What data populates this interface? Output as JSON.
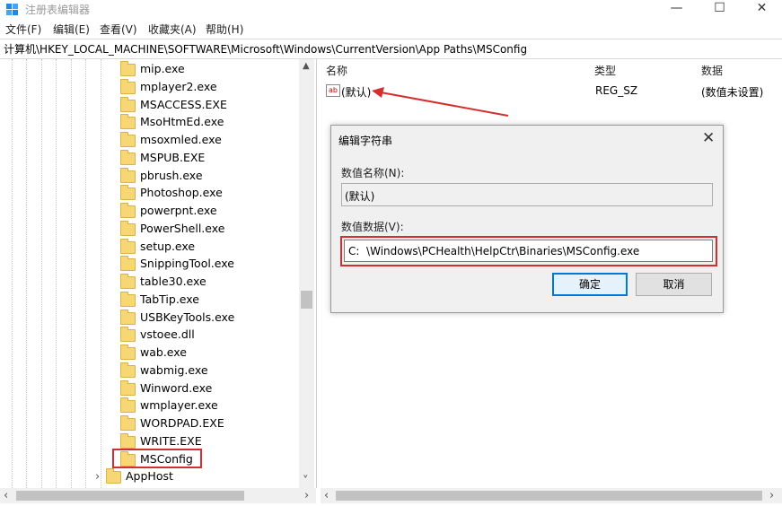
{
  "window": {
    "title": "注册表编辑器",
    "minimize": "—",
    "maximize": "☐",
    "close": "✕"
  },
  "menu": [
    "文件(F)",
    "编辑(E)",
    "查看(V)",
    "收藏夹(A)",
    "帮助(H)"
  ],
  "address": "计算机\\HKEY_LOCAL_MACHINE\\SOFTWARE\\Microsoft\\Windows\\CurrentVersion\\App Paths\\MSConfig",
  "tree": {
    "items": [
      "mip.exe",
      "mplayer2.exe",
      "MSACCESS.EXE",
      "MsoHtmEd.exe",
      "msoxmled.exe",
      "MSPUB.EXE",
      "pbrush.exe",
      "Photoshop.exe",
      "powerpnt.exe",
      "PowerShell.exe",
      "setup.exe",
      "SnippingTool.exe",
      "table30.exe",
      "TabTip.exe",
      "USBKeyTools.exe",
      "vstoee.dll",
      "wab.exe",
      "wabmig.exe",
      "Winword.exe",
      "wmplayer.exe",
      "WORDPAD.EXE",
      "WRITE.EXE",
      "MSConfig"
    ],
    "selected": "MSConfig",
    "sibling": "AppHost",
    "expand_glyph": "›"
  },
  "list": {
    "columns": {
      "name": "名称",
      "type": "类型",
      "data": "数据"
    },
    "rows": [
      {
        "icon": "ab",
        "name": "(默认)",
        "type": "REG_SZ",
        "data": "(数值未设置)"
      }
    ]
  },
  "dialog": {
    "title": "编辑字符串",
    "close": "✕",
    "name_label": "数值名称(N):",
    "name_value": "(默认)",
    "data_label": "数值数据(V):",
    "data_value": "C:  \\Windows\\PCHealth\\HelpCtr\\Binaries\\MSConfig.exe",
    "ok": "确定",
    "cancel": "取消"
  },
  "scroll": {
    "up": "▲",
    "down": "˅",
    "left": "‹",
    "right": "›"
  },
  "colors": {
    "annotation_red": "#d32f2f",
    "folder_yellow": "#f6d774",
    "ok_border": "#0078d7"
  }
}
